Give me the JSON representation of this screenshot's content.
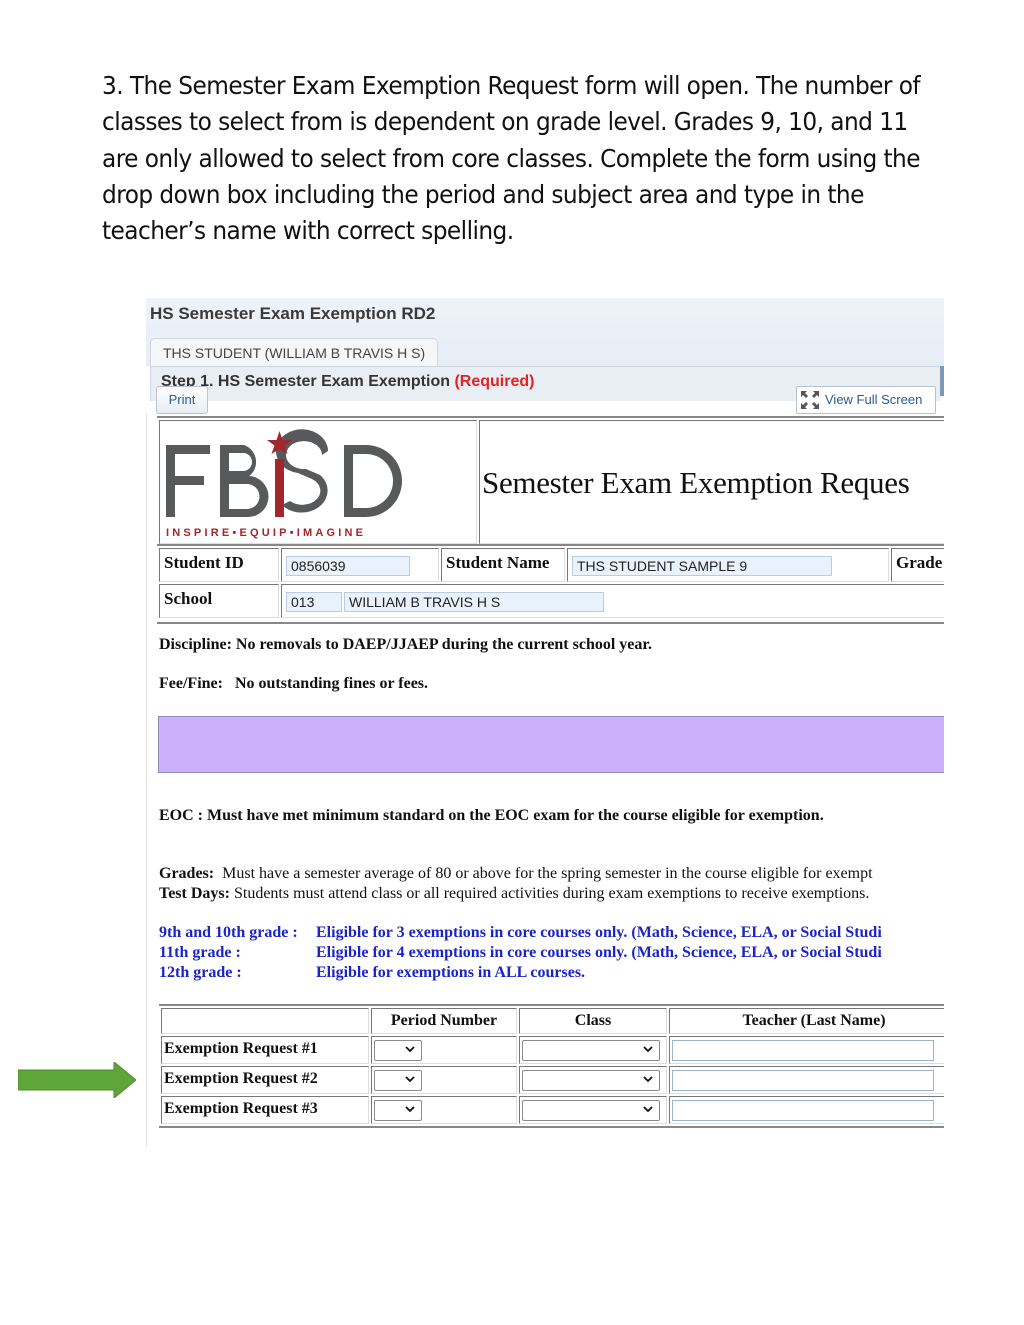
{
  "instructions": "3. The Semester Exam Exemption Request form will open. The number of classes to select from is dependent on grade level. Grades 9, 10, and 11 are only allowed to select from core classes. Complete the form using the drop down box including the period and subject area and type in the teacher’s name with correct spelling.",
  "annotation": {
    "arrow_color": "#5fa63a",
    "arrow_target": "Exemption Request #2"
  },
  "app": {
    "title": "HS Semester Exam Exemption RD2",
    "tab_label": "THS STUDENT (WILLIAM B TRAVIS H S)",
    "step_title": "Step 1. HS Semester Exam Exemption",
    "step_required": "(Required)",
    "print_label": "Print",
    "fullscreen_label": "View Full Screen"
  },
  "form": {
    "logo": {
      "text": "FBISD",
      "tagline": "INSPIRE•EQUIP•IMAGINE",
      "gray": "#58595b",
      "red": "#a3262c"
    },
    "title": "Semester Exam Exemption Reques",
    "student_id_label": "Student ID",
    "student_id_value": "0856039",
    "student_name_label": "Student Name",
    "student_name_value": "THS STUDENT SAMPLE 9",
    "grade_label": "Grade",
    "school_label": "School",
    "school_code": "013",
    "school_name": "WILLIAM B TRAVIS H S",
    "discipline_label": "Discipline:",
    "discipline_text": "No removals to DAEP/JJAEP during the current school year.",
    "fee_label": "Fee/Fine:",
    "fee_text": "No outstanding fines or fees.",
    "eoc_text": "EOC : Must have met minimum standard on the EOC exam for the course eligible for exemption.",
    "grades_label": "Grades:",
    "grades_text": "Must have a semester average of 80 or above for the spring semester in the course eligible for exempt",
    "testdays_label": "Test Days:",
    "testdays_text": "Students must attend class or all required activities during exam exemptions to receive exemptions.",
    "eligibility": [
      {
        "grade": "9th and 10th grade :",
        "rule": "Eligible for 3 exemptions in core courses only. (Math, Science, ELA, or Social Studi"
      },
      {
        "grade": "11th grade :",
        "rule": "Eligible for 4 exemptions in core courses only. (Math, Science, ELA, or Social Studi"
      },
      {
        "grade": "12th grade  :",
        "rule": "Eligible for exemptions in ALL courses."
      }
    ],
    "table": {
      "headers": [
        "",
        "Period Number",
        "Class",
        "Teacher (Last Name)"
      ],
      "rows": [
        {
          "label": "Exemption Request #1",
          "period": "",
          "class": "",
          "teacher": ""
        },
        {
          "label": "Exemption Request #2",
          "period": "",
          "class": "",
          "teacher": ""
        },
        {
          "label": "Exemption Request #3",
          "period": "",
          "class": "",
          "teacher": ""
        }
      ]
    }
  }
}
